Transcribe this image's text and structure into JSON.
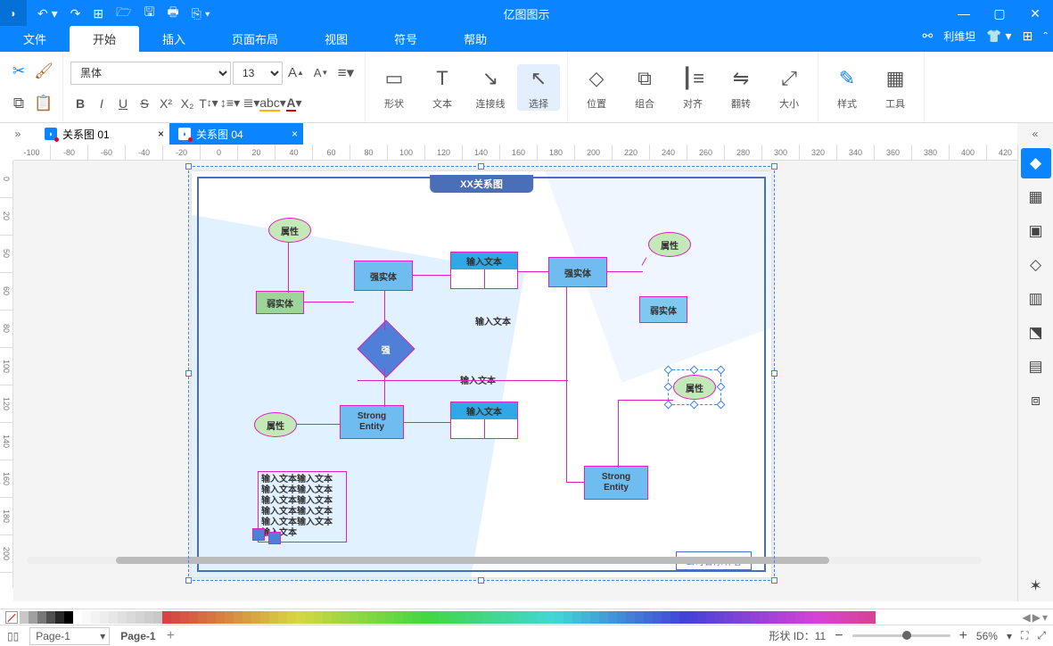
{
  "app": {
    "title": "亿图图示"
  },
  "menu": {
    "file": "文件",
    "start": "开始",
    "insert": "插入",
    "page": "页面布局",
    "view": "视图",
    "symbol": "符号",
    "help": "帮助",
    "user": "利维坦"
  },
  "toolbar": {
    "font_family": "黑体",
    "font_size": "13",
    "shape": "形状",
    "text": "文本",
    "connector": "连接线",
    "select": "选择",
    "position": "位置",
    "group": "组合",
    "align": "对齐",
    "flip": "翻转",
    "size": "大小",
    "style": "样式",
    "tools": "工具"
  },
  "tabs": {
    "t1": "关系图 01",
    "t2": "关系图 04"
  },
  "ruler_h": [
    "-100",
    "-80",
    "-60",
    "-40",
    "-20",
    "0",
    "20",
    "40",
    "60",
    "80",
    "100",
    "120",
    "140",
    "160",
    "180",
    "200",
    "220",
    "240",
    "260",
    "280",
    "300",
    "320",
    "340",
    "360",
    "380",
    "400",
    "420"
  ],
  "ruler_v": [
    "0",
    "20",
    "50",
    "60",
    "80",
    "100",
    "120",
    "140",
    "160",
    "180",
    "200"
  ],
  "diagram": {
    "title": "XX关系图",
    "attr": "属性",
    "strong_entity_cn": "强实体",
    "weak_entity_cn": "弱实体",
    "strong_entity_en": "Strong\nEntity",
    "relation": "强",
    "input_text": "输入文本",
    "textbox_line": "输入文本输入文本",
    "footer": "公司名称/作者"
  },
  "status": {
    "page_sel": "Page-1",
    "page_label": "Page-1",
    "shape_id_label": "形状 ID：",
    "shape_id": "11",
    "zoom": "56%"
  }
}
